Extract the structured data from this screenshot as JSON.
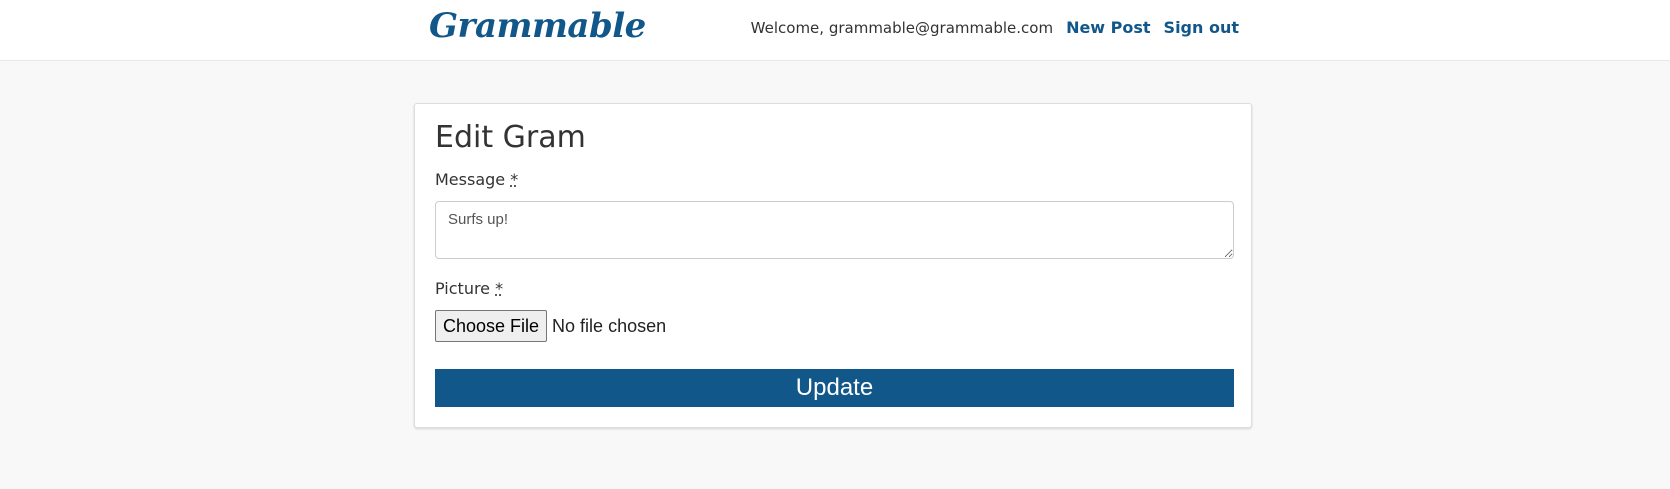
{
  "navbar": {
    "brand": "Grammable",
    "welcome": "Welcome, grammable@grammable.com",
    "new_post": "New Post",
    "sign_out": "Sign out"
  },
  "form": {
    "title": "Edit Gram",
    "message_label": "Message",
    "required_marker": "*",
    "message_value": "Surfs up!",
    "picture_label": "Picture",
    "file_button": "Choose File",
    "file_status": "No file chosen",
    "submit": "Update"
  },
  "colors": {
    "brand": "#11578a",
    "background": "#f8f8f8"
  }
}
